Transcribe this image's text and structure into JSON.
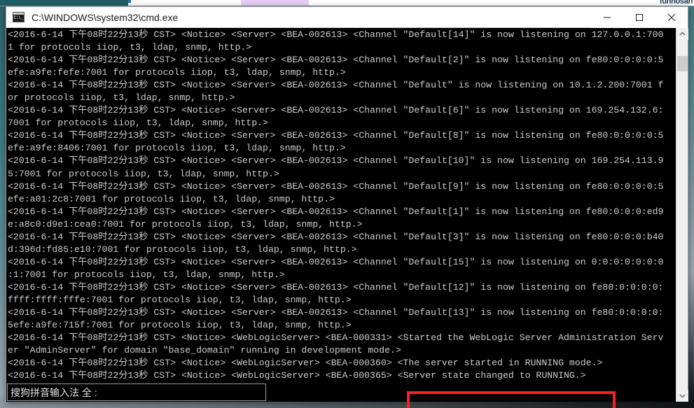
{
  "desktop": {
    "background_top_strip": {
      "tab_teal_color": "#1f5c63",
      "tab_lavender_color": "#e8cdf7",
      "partial_text_right": "funnosan"
    }
  },
  "window": {
    "title": "C:\\WINDOWS\\system32\\cmd.exe",
    "icon": "cmd-icon",
    "controls": {
      "minimize": "minimize-icon",
      "maximize": "maximize-icon",
      "close": "close-icon"
    }
  },
  "console": {
    "foreground_color": "#cccccc",
    "background_color": "#000000",
    "lines": [
      "<2016-6-14 下午08时22分13秒 CST> <Notice> <Server> <BEA-002613> <Channel \"Default[14]\" is now listening on 127.0.0.1:700",
      "1 for protocols iiop, t3, ldap, snmp, http.>",
      "<2016-6-14 下午08时22分13秒 CST> <Notice> <Server> <BEA-002613> <Channel \"Default[2]\" is now listening on fe80:0:0:0:0:5",
      "efe:a9fe:fefe:7001 for protocols iiop, t3, ldap, snmp, http.>",
      "<2016-6-14 下午08时22分13秒 CST> <Notice> <Server> <BEA-002613> <Channel \"Default\" is now listening on 10.1.2.200:7001 f",
      "or protocols iiop, t3, ldap, snmp, http.>",
      "<2016-6-14 下午08时22分13秒 CST> <Notice> <Server> <BEA-002613> <Channel \"Default[6]\" is now listening on 169.254.132.6:",
      "7001 for protocols iiop, t3, ldap, snmp, http.>",
      "<2016-6-14 下午08时22分13秒 CST> <Notice> <Server> <BEA-002613> <Channel \"Default[8]\" is now listening on fe80:0:0:0:0:5",
      "efe:a9fe:8406:7001 for protocols iiop, t3, ldap, snmp, http.>",
      "<2016-6-14 下午08时22分13秒 CST> <Notice> <Server> <BEA-002613> <Channel \"Default[10]\" is now listening on 169.254.113.9",
      "5:7001 for protocols iiop, t3, ldap, snmp, http.>",
      "<2016-6-14 下午08时22分13秒 CST> <Notice> <Server> <BEA-002613> <Channel \"Default[9]\" is now listening on fe80:0:0:0:0:5",
      "efe:a01:2c8:7001 for protocols iiop, t3, ldap, snmp, http.>",
      "<2016-6-14 下午08时22分13秒 CST> <Notice> <Server> <BEA-002613> <Channel \"Default[1]\" is now listening on fe80:0:0:0:ed9",
      "e:a8c0:d9e1:cea0:7001 for protocols iiop, t3, ldap, snmp, http.>",
      "<2016-6-14 下午08时22分13秒 CST> <Notice> <Server> <BEA-002613> <Channel \"Default[3]\" is now listening on fe80:0:0:0:b40",
      "d:396d:fd85:e10:7001 for protocols iiop, t3, ldap, snmp, http.>",
      "<2016-6-14 下午08时22分13秒 CST> <Notice> <Server> <BEA-002613> <Channel \"Default[15]\" is now listening on 0:0:0:0:0:0:0",
      ":1:7001 for protocols iiop, t3, ldap, snmp, http.>",
      "<2016-6-14 下午08时22分13秒 CST> <Notice> <Server> <BEA-002613> <Channel \"Default[12]\" is now listening on fe80:0:0:0:0:",
      "ffff:ffff:fffe:7001 for protocols iiop, t3, ldap, snmp, http.>",
      "<2016-6-14 下午08时22分13秒 CST> <Notice> <Server> <BEA-002613> <Channel \"Default[13]\" is now listening on fe80:0:0:0:0:",
      "5efe:a9fe:715f:7001 for protocols iiop, t3, ldap, snmp, http.>",
      "<2016-6-14 下午08时22分13秒 CST> <Notice> <WebLogicServer> <BEA-000331> <Started the WebLogic Server Administration Serv",
      "er \"AdminServer\" for domain \"base_domain\" running in development mode.>",
      "<2016-6-14 下午08时22分13秒 CST> <Notice> <WebLogicServer> <BEA-000360> <The server started in RUNNING mode.>",
      "<2016-6-14 下午08时22分13秒 CST> <Notice> <WebLogicServer> <BEA-000365> <Server state changed to RUNNING.>"
    ]
  },
  "annotation": {
    "highlight_color": "#fb1f1f",
    "highlighted_text": "<Server state changed to RUNNING.>"
  },
  "scrollbar": {
    "up_arrow": "chevron-up-icon",
    "down_arrow": "chevron-down-icon",
    "thumb": "scrollbar-thumb"
  },
  "ime": {
    "text": "搜狗拼音输入法 全 :"
  }
}
